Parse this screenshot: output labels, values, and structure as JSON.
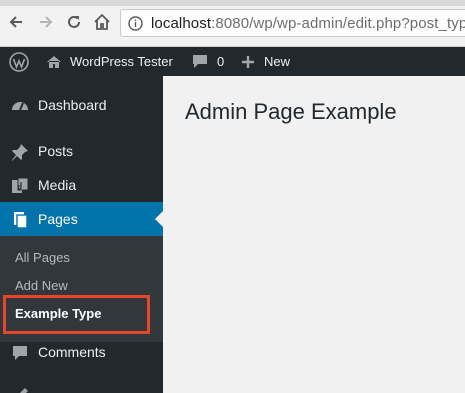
{
  "browser": {
    "url_host": "localhost",
    "url_rest": ":8080/wp/wp-admin/edit.php?post_typ"
  },
  "adminbar": {
    "site_name": "WordPress Tester",
    "comments_count": "0",
    "new_label": "New"
  },
  "sidebar": {
    "items": [
      {
        "label": "Dashboard",
        "icon": "dashboard-icon"
      },
      {
        "label": "Posts",
        "icon": "pin-icon"
      },
      {
        "label": "Media",
        "icon": "media-icon"
      },
      {
        "label": "Pages",
        "icon": "pages-icon",
        "current": true
      },
      {
        "label": "Comments",
        "icon": "comment-icon"
      }
    ],
    "submenu": [
      {
        "label": "All Pages"
      },
      {
        "label": "Add New"
      },
      {
        "label": "Example Type",
        "current": true
      }
    ]
  },
  "main": {
    "title": "Admin Page Example"
  },
  "colors": {
    "adminbar": "#23282d",
    "sidebar": "#23282d",
    "submenu": "#32373c",
    "current": "#0073aa",
    "highlight": "#e8452a",
    "content": "#f1f1f1"
  }
}
